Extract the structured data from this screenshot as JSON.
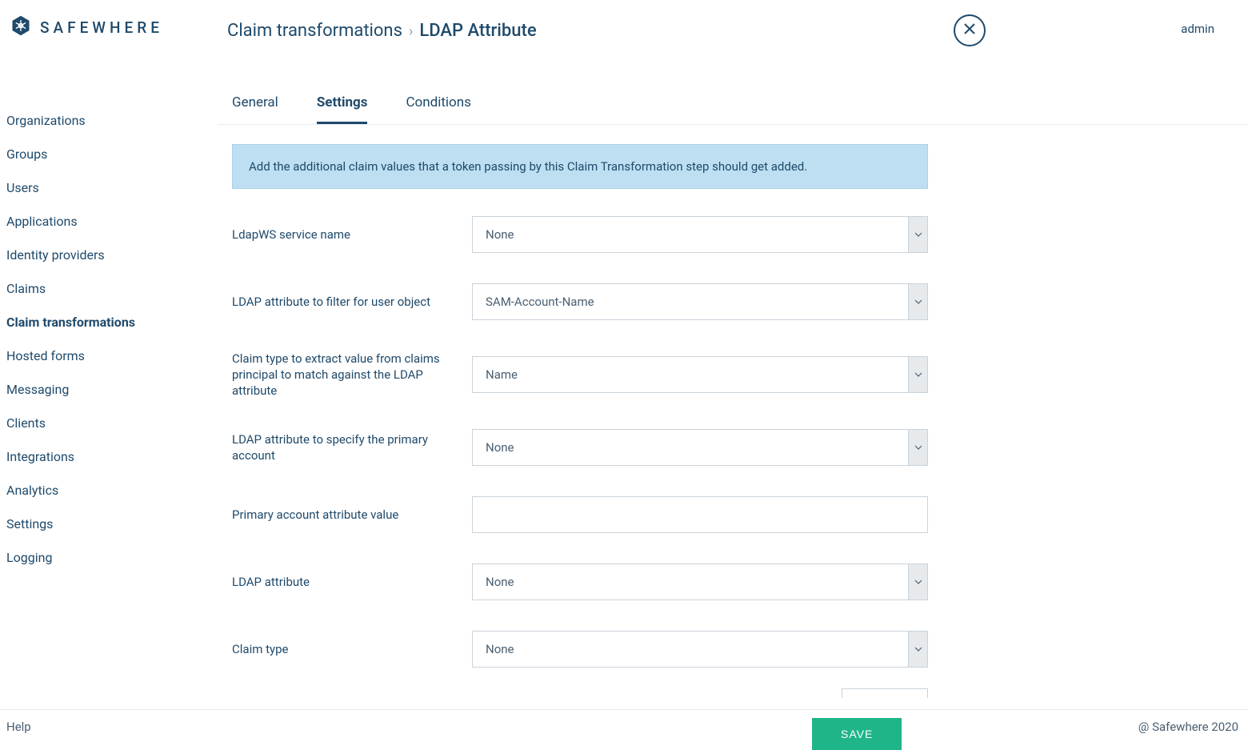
{
  "brand": "SAFEWHERE",
  "user": "admin",
  "breadcrumb": {
    "parent": "Claim transformations",
    "separator": "›",
    "current": "LDAP Attribute"
  },
  "sidebar": {
    "items": [
      {
        "label": "Organizations"
      },
      {
        "label": "Groups"
      },
      {
        "label": "Users"
      },
      {
        "label": "Applications"
      },
      {
        "label": "Identity providers"
      },
      {
        "label": "Claims"
      },
      {
        "label": "Claim transformations",
        "active": true
      },
      {
        "label": "Hosted forms"
      },
      {
        "label": "Messaging"
      },
      {
        "label": "Clients"
      },
      {
        "label": "Integrations"
      },
      {
        "label": "Analytics"
      },
      {
        "label": "Settings"
      },
      {
        "label": "Logging"
      }
    ]
  },
  "tabs": [
    {
      "label": "General"
    },
    {
      "label": "Settings",
      "active": true
    },
    {
      "label": "Conditions"
    }
  ],
  "info": "Add the additional claim values that a token passing by this Claim Transformation step should get added.",
  "form": {
    "ldapws_service_name": {
      "label": "LdapWS service name",
      "value": "None"
    },
    "ldap_filter_attr": {
      "label": "LDAP attribute to filter for user object",
      "value": "SAM-Account-Name"
    },
    "claim_type_match": {
      "label": "Claim type to extract value from claims principal to match against the LDAP attribute",
      "value": "Name"
    },
    "ldap_primary_attr": {
      "label": "LDAP attribute to specify the primary account",
      "value": "None"
    },
    "primary_account_value": {
      "label": "Primary account attribute value",
      "value": ""
    },
    "ldap_attribute": {
      "label": "LDAP attribute",
      "value": "None"
    },
    "claim_type": {
      "label": "Claim type",
      "value": "None"
    }
  },
  "buttons": {
    "save": "SAVE"
  },
  "footer": {
    "help": "Help",
    "copyright": "@ Safewhere 2020"
  }
}
